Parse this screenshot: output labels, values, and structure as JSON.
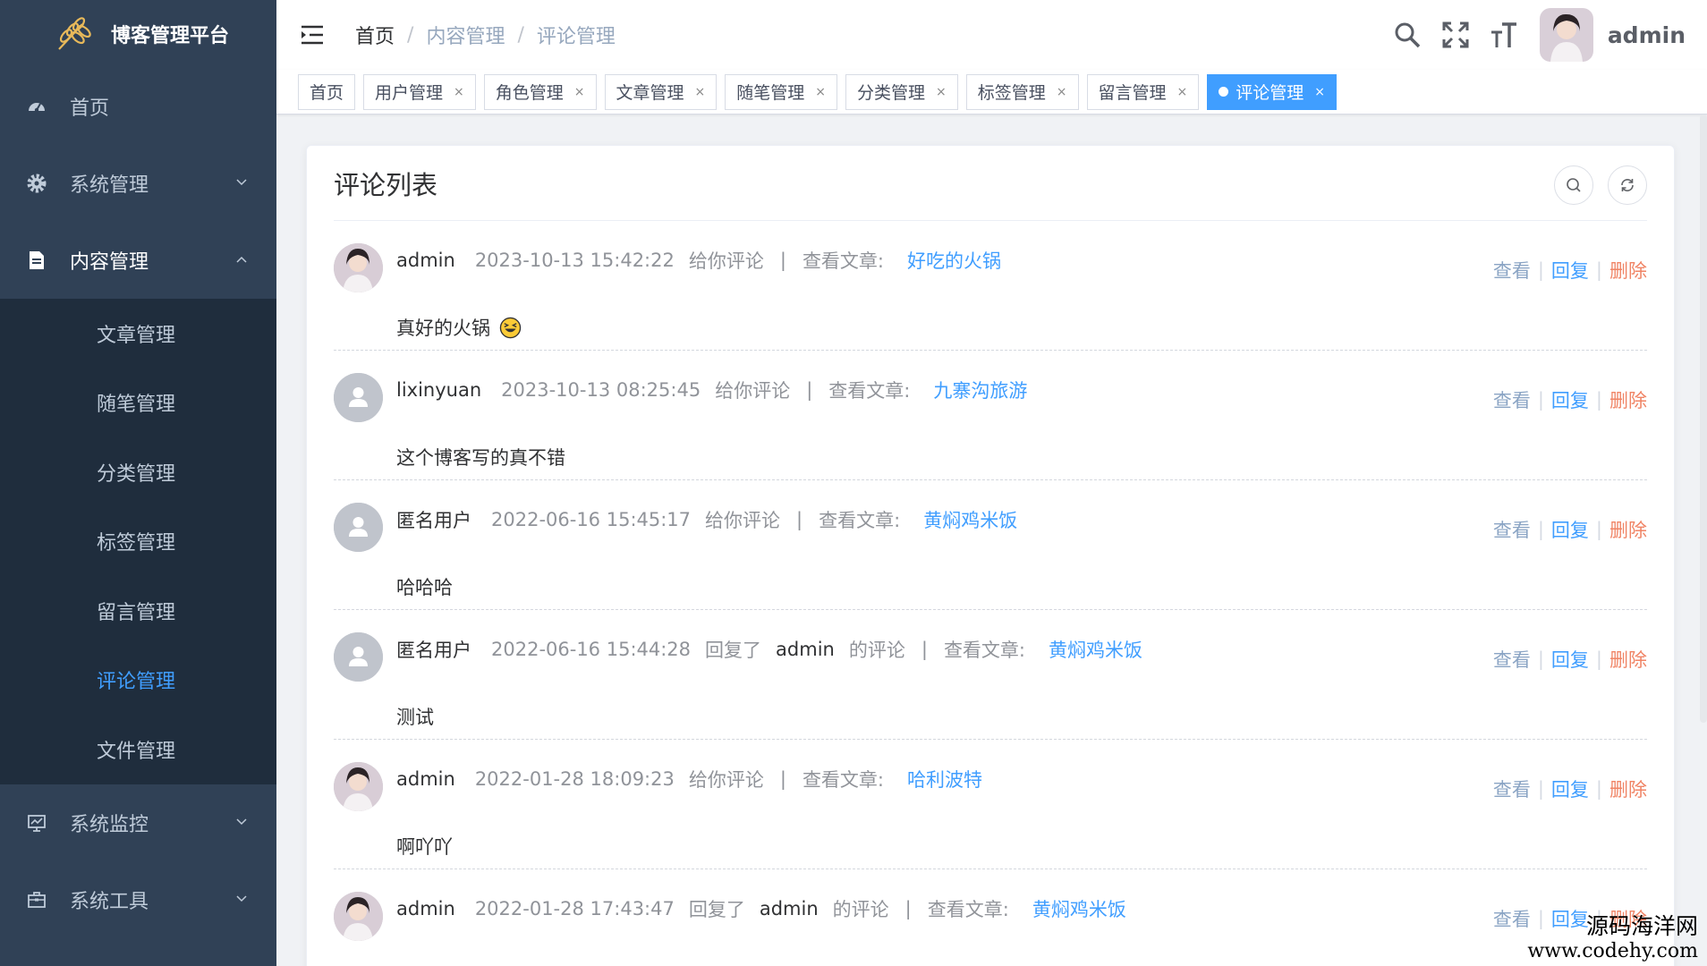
{
  "sidebar": {
    "logo_title": "博客管理平台",
    "menu": [
      {
        "label": "首页",
        "icon": "dashboard-icon"
      },
      {
        "label": "系统管理",
        "icon": "gear-icon"
      },
      {
        "label": "内容管理",
        "icon": "document-icon"
      },
      {
        "label": "系统监控",
        "icon": "monitor-icon"
      },
      {
        "label": "系统工具",
        "icon": "toolbox-icon"
      }
    ],
    "submenu": [
      "文章管理",
      "随笔管理",
      "分类管理",
      "标签管理",
      "留言管理",
      "评论管理",
      "文件管理"
    ]
  },
  "header": {
    "breadcrumb": [
      "首页",
      "内容管理",
      "评论管理"
    ],
    "username": "admin"
  },
  "tags": [
    "首页",
    "用户管理",
    "角色管理",
    "文章管理",
    "随笔管理",
    "分类管理",
    "标签管理",
    "留言管理",
    "评论管理"
  ],
  "card": {
    "title": "评论列表"
  },
  "labels": {
    "to_you": "给你评论",
    "replied": "回复了",
    "whose_comment": "的评论",
    "view_article": "查看文章:",
    "pipe": "|",
    "view": "查看",
    "reply": "回复",
    "delete": "删除"
  },
  "comments": [
    {
      "user": "admin",
      "time": "2023-10-13 15:42:22",
      "type": "direct",
      "article": "好吃的火锅",
      "content": "真好的火锅",
      "emoji": true,
      "avatar": "photo"
    },
    {
      "user": "lixinyuan",
      "time": "2023-10-13 08:25:45",
      "type": "direct",
      "article": "九寨沟旅游",
      "content": "这个博客写的真不错",
      "avatar": "default"
    },
    {
      "user": "匿名用户",
      "time": "2022-06-16 15:45:17",
      "type": "direct",
      "article": "黄焖鸡米饭",
      "content": "哈哈哈",
      "avatar": "default"
    },
    {
      "user": "匿名用户",
      "time": "2022-06-16 15:44:28",
      "type": "reply",
      "reply_to": "admin",
      "article": "黄焖鸡米饭",
      "content": "测试",
      "avatar": "default"
    },
    {
      "user": "admin",
      "time": "2022-01-28 18:09:23",
      "type": "direct",
      "article": "哈利波特",
      "content": "啊吖吖",
      "avatar": "photo"
    },
    {
      "user": "admin",
      "time": "2022-01-28 17:43:47",
      "type": "reply",
      "reply_to": "admin",
      "article": "黄焖鸡米饭",
      "content": "",
      "avatar": "photo"
    }
  ],
  "watermark": {
    "line1": "源码海洋网",
    "line2": "www.codehy.com"
  },
  "colors": {
    "sidebar": "#304156",
    "submenu": "#1f2d3d",
    "accent": "#409eff",
    "danger": "#f08465"
  }
}
